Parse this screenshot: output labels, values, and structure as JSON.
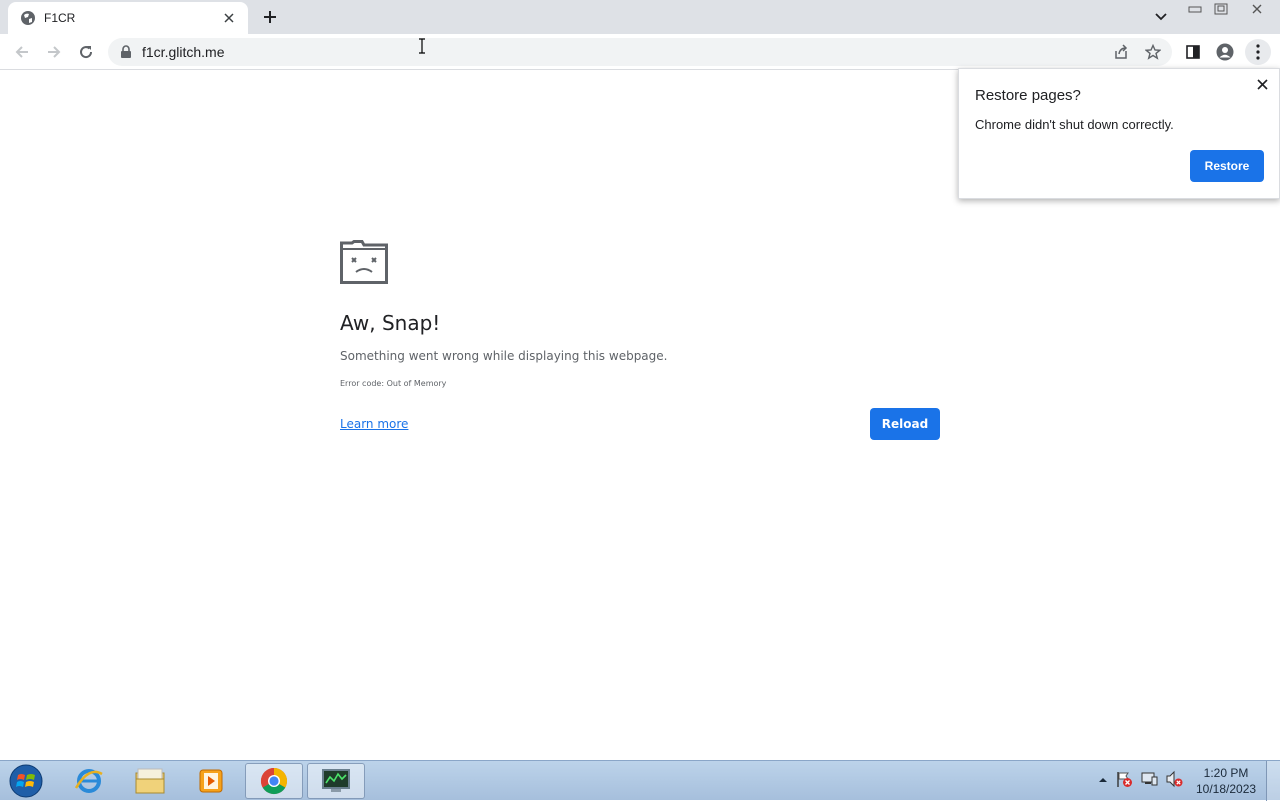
{
  "browser": {
    "tab": {
      "title": "F1CR",
      "favicon": "globe-icon"
    },
    "new_tab_icon": "plus-icon",
    "address": {
      "url": "f1cr.glitch.me",
      "lock_icon": "lock-icon"
    }
  },
  "page": {
    "title": "Aw, Snap!",
    "message": "Something went wrong while displaying this webpage.",
    "error_code": "Error code: Out of Memory",
    "learn_more": "Learn more",
    "reload": "Reload"
  },
  "restore_bubble": {
    "title": "Restore pages?",
    "text": "Chrome didn't shut down correctly.",
    "button": "Restore"
  },
  "taskbar": {
    "clock_time": "1:20 PM",
    "clock_date": "10/18/2023",
    "apps": [
      "internet-explorer-icon",
      "file-explorer-icon",
      "media-player-icon",
      "chrome-icon",
      "task-manager-icon"
    ]
  },
  "colors": {
    "accent": "#1a73e8",
    "tabstrip": "#dee1e6",
    "omnibox": "#f1f3f4"
  }
}
